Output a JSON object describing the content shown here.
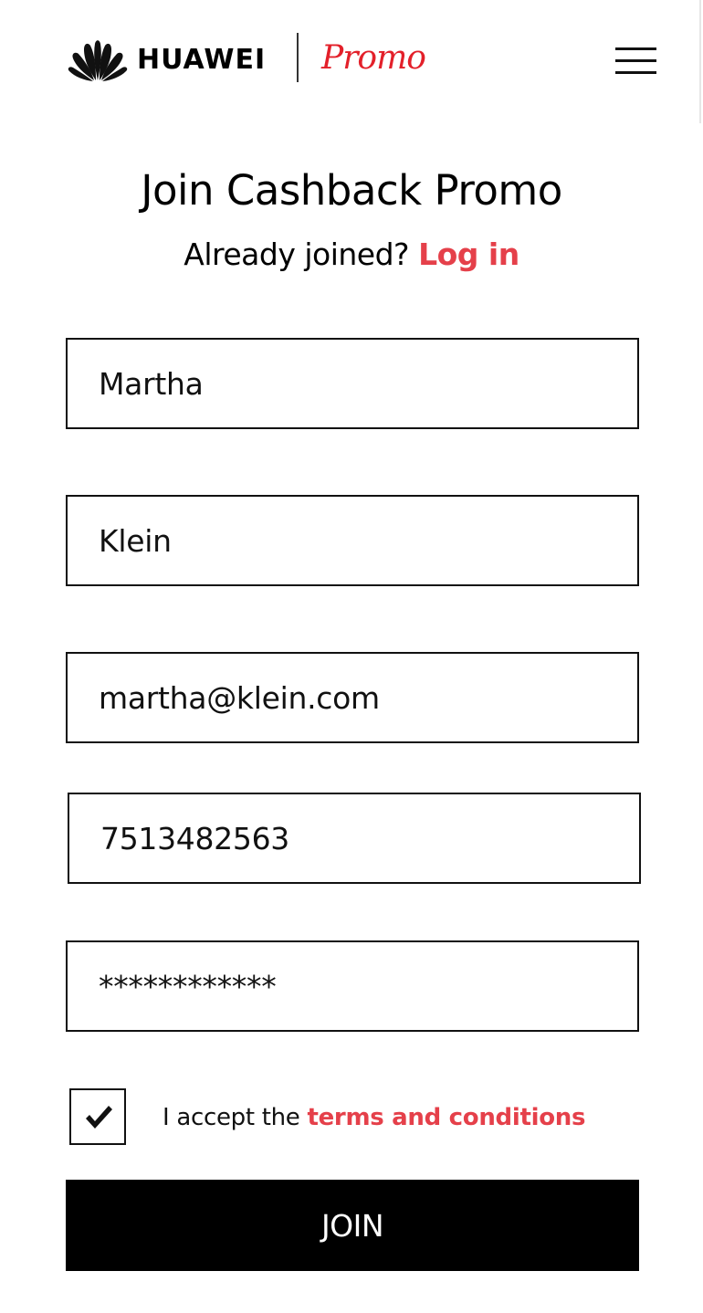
{
  "header": {
    "brand_name": "HUAWEI",
    "brand_sub": "Promo",
    "logo_icon": "huawei-petal-logo",
    "menu_icon": "hamburger-menu-icon"
  },
  "page": {
    "title": "Join Cashback Promo",
    "already_joined": "Already joined?",
    "login_link": "Log in"
  },
  "form": {
    "first_name": "Martha",
    "last_name": "Klein",
    "email": "martha@klein.com",
    "phone": "7513482563",
    "password": "************",
    "terms_prefix": "I accept the",
    "terms_link": "terms and conditions",
    "terms_checked": true,
    "join_label": "JOIN"
  },
  "colors": {
    "accent": "#e5404a",
    "brand_red": "#e3202a",
    "button_bg": "#000000"
  }
}
